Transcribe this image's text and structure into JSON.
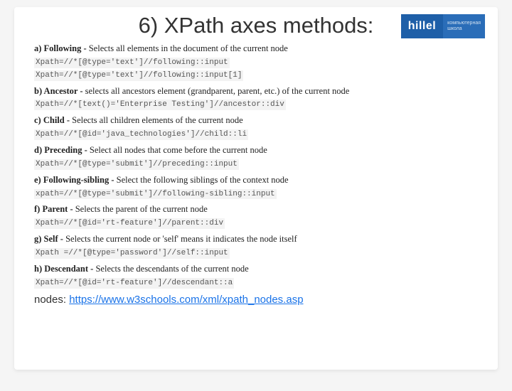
{
  "title": "6) XPath axes methods:",
  "logo": {
    "main": "hillel",
    "sub1": "компьютерная",
    "sub2": "школа"
  },
  "sections": [
    {
      "label": "a) Following - ",
      "desc": "Selects all elements in the document of the current node",
      "code": [
        "Xpath=//*[@type='text']//following::input",
        "Xpath=//*[@type='text']//following::input[1]"
      ]
    },
    {
      "label": "b) Ancestor - ",
      "desc": " selects all ancestors element (grandparent, parent, etc.) of the current node",
      "code": [
        "Xpath=//*[text()='Enterprise Testing']//ancestor::div"
      ]
    },
    {
      "label": "c) Child - ",
      "desc": "Selects all children elements of the current node",
      "code": [
        "Xpath=//*[@id='java_technologies']//child::li"
      ]
    },
    {
      "label": "d) Preceding - ",
      "desc": "Select all nodes that come before the current node",
      "code": [
        "Xpath=//*[@type='submit']//preceding::input"
      ]
    },
    {
      "label": "e) Following-sibling - ",
      "desc": "Select the following siblings of the context node",
      "code": [
        "xpath=//*[@type='submit']//following-sibling::input"
      ]
    },
    {
      "label": "f) Parent - ",
      "desc": "Selects the parent of the current node",
      "code": [
        "Xpath=//*[@id='rt-feature']//parent::div"
      ]
    },
    {
      "label": "g) Self - ",
      "desc": "Selects the current node or 'self' means it indicates the node itself",
      "code": [
        "Xpath =//*[@type='password']//self::input"
      ]
    },
    {
      "label": "h) Descendant - ",
      "desc": "Selects the descendants of the current node",
      "code": [
        "Xpath=//*[@id='rt-feature']//descendant::a"
      ]
    }
  ],
  "footer": {
    "prefix": "nodes: ",
    "link_text": "https://www.w3schools.com/xml/xpath_nodes.asp",
    "link_href": "https://www.w3schools.com/xml/xpath_nodes.asp"
  }
}
